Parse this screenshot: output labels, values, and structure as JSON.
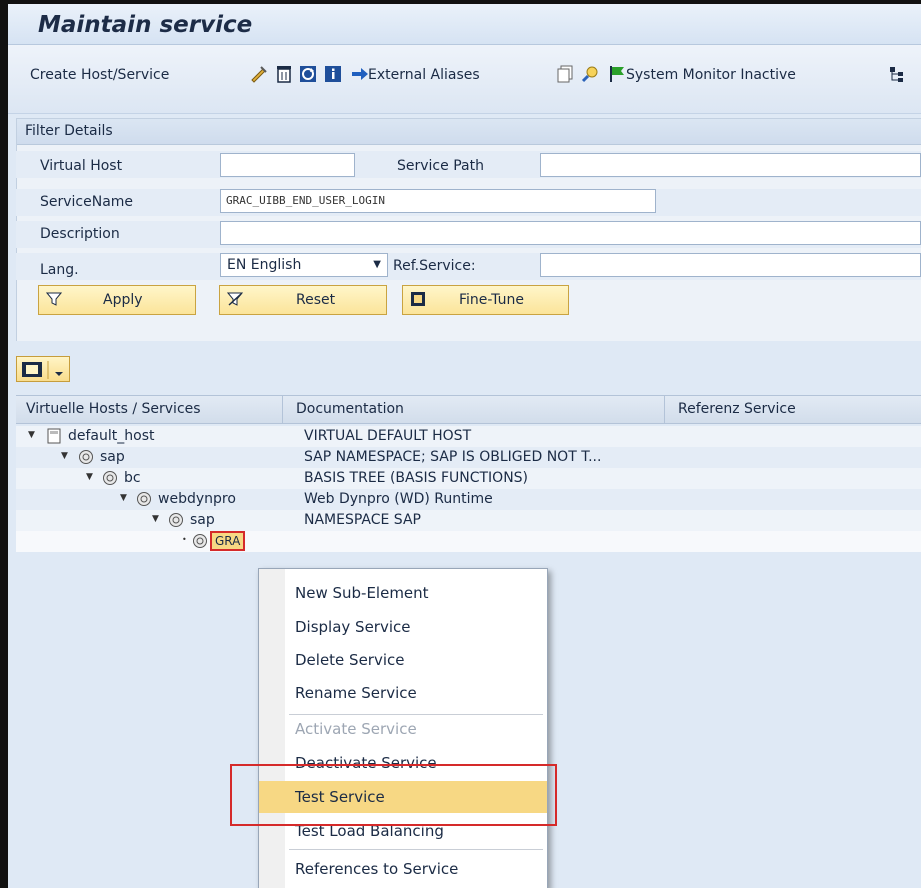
{
  "window": {
    "title": "Maintain service"
  },
  "toolbar": {
    "create_host_service": "Create Host/Service",
    "external_aliases": "External Aliases",
    "system_monitor": "System Monitor Inactive"
  },
  "filter": {
    "header": "Filter Details",
    "virtual_host_label": "Virtual Host",
    "virtual_host_value": "",
    "service_path_label": "Service Path",
    "service_path_value": "",
    "service_name_label": "ServiceName",
    "service_name_value": "GRAC_UIBB_END_USER_LOGIN",
    "description_label": "Description",
    "description_value": "",
    "lang_label": "Lang.",
    "lang_value": "EN English",
    "ref_service_label": "Ref.Service:",
    "ref_service_value": "",
    "apply": "Apply",
    "reset": "Reset",
    "fine_tune": "Fine-Tune"
  },
  "grid": {
    "columns": [
      "Virtuelle Hosts / Services",
      "Documentation",
      "Referenz Service"
    ],
    "rows": [
      {
        "name": "default_host",
        "doc": "VIRTUAL DEFAULT HOST"
      },
      {
        "name": "sap",
        "doc": "SAP NAMESPACE; SAP IS OBLIGED NOT T..."
      },
      {
        "name": "bc",
        "doc": "BASIS TREE (BASIS FUNCTIONS)"
      },
      {
        "name": "webdynpro",
        "doc": "Web Dynpro (WD) Runtime"
      },
      {
        "name": "sap",
        "doc": "NAMESPACE SAP"
      },
      {
        "name": "GRA",
        "doc": ""
      }
    ]
  },
  "context_menu": {
    "items": [
      "New Sub-Element",
      "Display Service",
      "Delete Service",
      "Rename Service",
      "Activate Service",
      "Deactivate Service",
      "Test Service",
      "Test Load Balancing",
      "References to Service"
    ]
  },
  "colors": {
    "highlight": "#f7d884",
    "red_box": "#d52a2a",
    "panel": "#edf2f8"
  }
}
